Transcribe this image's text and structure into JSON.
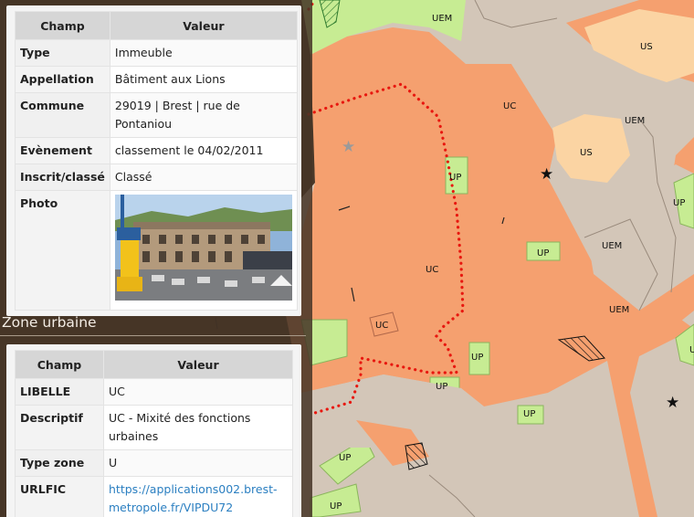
{
  "map": {
    "zones": [
      {
        "label": "UEM"
      },
      {
        "label": "US"
      },
      {
        "label": "UC"
      },
      {
        "label": "UEM"
      },
      {
        "label": "US"
      },
      {
        "label": "UP"
      },
      {
        "label": "UP"
      },
      {
        "label": "UC"
      },
      {
        "label": "UP"
      },
      {
        "label": "UEM"
      },
      {
        "label": "UEM"
      },
      {
        "label": "UP"
      },
      {
        "label": "UC"
      },
      {
        "label": "UP"
      },
      {
        "label": "UP"
      },
      {
        "label": "UP"
      },
      {
        "label": "UP"
      },
      {
        "label": "UP"
      },
      {
        "label": "UP"
      }
    ],
    "colors": {
      "uc": "#f5a06f",
      "up": "#c7ec93",
      "us": "#fbd4a3",
      "uem": "#d3c6b8",
      "boundary": "#e8170f"
    },
    "icons": [
      "star-icon",
      "star-icon",
      "star-icon"
    ]
  },
  "monument": {
    "columns": {
      "champ": "Champ",
      "valeur": "Valeur"
    },
    "rows": [
      {
        "key": "Type",
        "value": "Immeuble"
      },
      {
        "key": "Appellation",
        "value": "Bâtiment aux Lions"
      },
      {
        "key": "Commune",
        "value": "29019 | Brest | rue de Pontaniou"
      },
      {
        "key": "Evènement",
        "value": "classement le 04/02/2011"
      },
      {
        "key": "Inscrit/classé",
        "value": "Classé"
      },
      {
        "key": "Photo",
        "value": ""
      }
    ]
  },
  "zone": {
    "title": "Zone urbaine",
    "columns": {
      "champ": "Champ",
      "valeur": "Valeur"
    },
    "rows": [
      {
        "key": "LIBELLE",
        "value": "UC"
      },
      {
        "key": "Descriptif",
        "value": "UC - Mixité des fonctions urbaines"
      },
      {
        "key": "Type zone",
        "value": "U"
      },
      {
        "key": "URLFIC",
        "value": "https://applications002.brest-metropole.fr/VIPDU72"
      }
    ]
  }
}
